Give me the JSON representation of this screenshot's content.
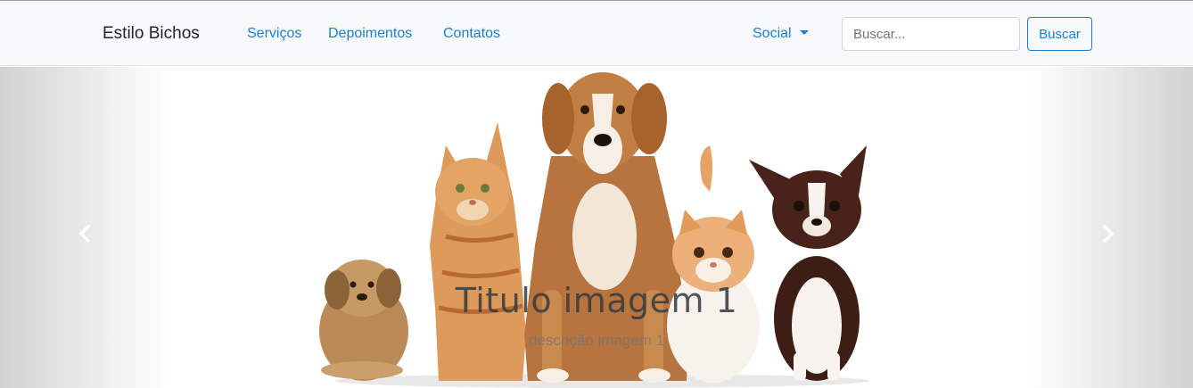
{
  "navbar": {
    "brand": "Estilo Bichos",
    "links": [
      "Serviços",
      "Depoimentos",
      "Contatos"
    ],
    "dropdown_label": "Social",
    "search_placeholder": "Buscar...",
    "search_value": "",
    "search_button": "Buscar"
  },
  "carousel": {
    "slide_title": "Titulo imagem 1",
    "slide_description": "descrição imagem 1",
    "image_alt": "Cachorros e gatos",
    "prev_icon": "chevron-left-icon",
    "next_icon": "chevron-right-icon"
  },
  "colors": {
    "link": "#1c7ed6",
    "navbar_bg": "#f8f9fa",
    "brand_text": "#212529"
  }
}
